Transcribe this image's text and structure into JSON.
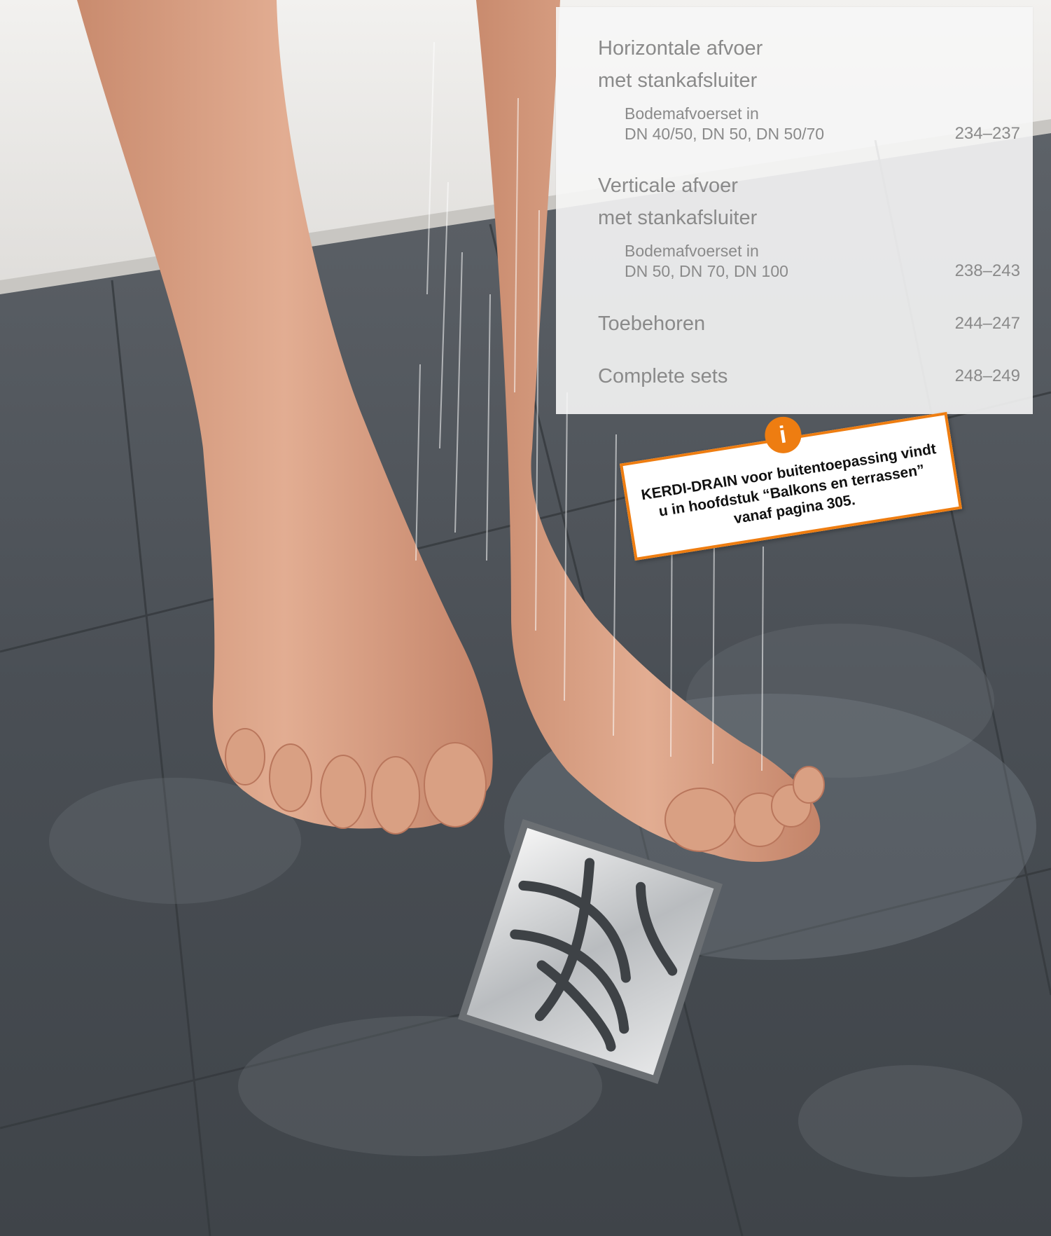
{
  "toc": {
    "entries": [
      {
        "heading_line1": "Horizontale afvoer",
        "heading_line2": "met stankafsluiter",
        "sub_line1": "Bodemafvoerset in",
        "sub_line2": "DN 40/50, DN 50, DN 50/70",
        "pages": "234–237"
      },
      {
        "heading_line1": "Verticale afvoer",
        "heading_line2": "met stankafsluiter",
        "sub_line1": "Bodemafvoerset in",
        "sub_line2": "DN 50, DN 70, DN 100",
        "pages": "238–243"
      },
      {
        "heading": "Toebehoren",
        "pages": "244–247"
      },
      {
        "heading": "Complete sets",
        "pages": "248–249"
      }
    ]
  },
  "note": {
    "badge": "i",
    "line1": "KERDI-DRAIN voor buitentoepassing vindt",
    "line2": "u in hoofdstuk “Balkons en terrassen”",
    "line3": "vanaf pagina 305."
  },
  "colors": {
    "accent": "#ee7d11",
    "panel_text": "#8a8a8a",
    "tile": "#4c5156",
    "skin": "#d9a083"
  }
}
